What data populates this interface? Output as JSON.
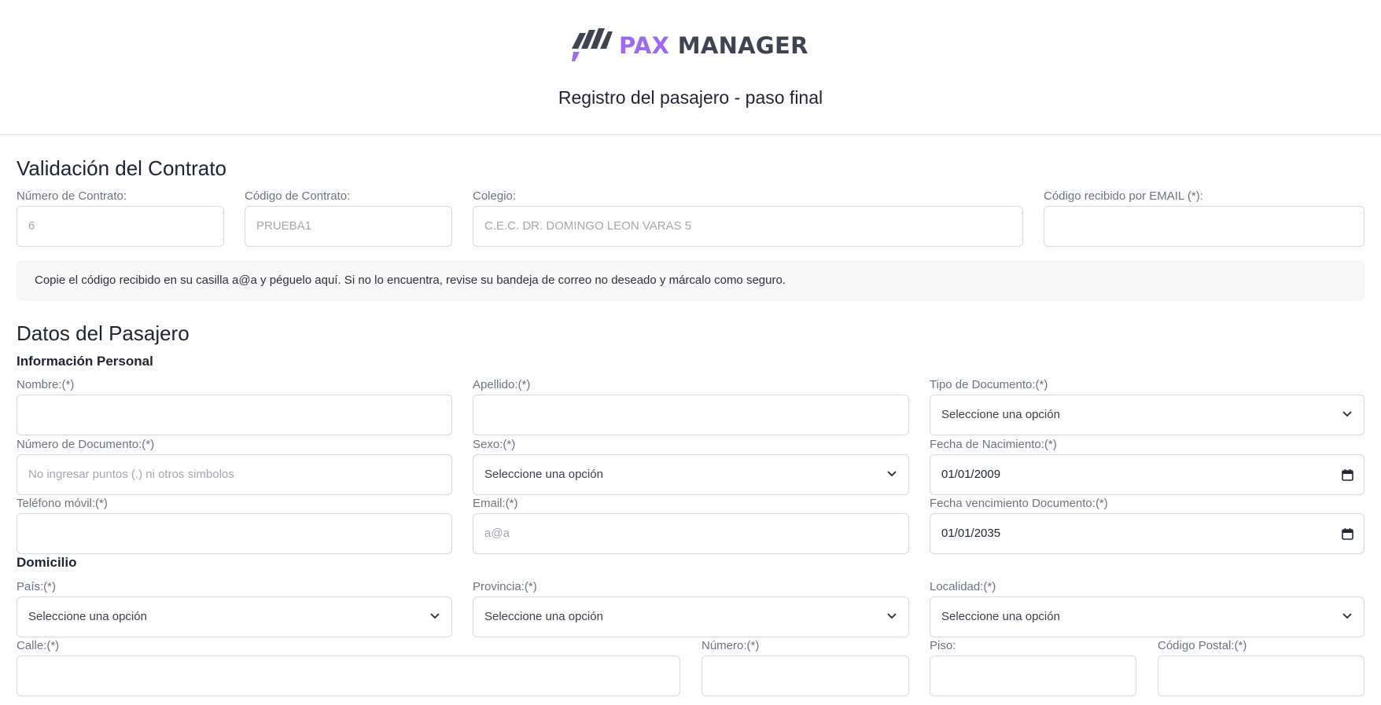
{
  "brand": {
    "pax": "PAX",
    "manager": "MANAGER",
    "accent": "#9d6af2",
    "dark": "#3f4453"
  },
  "page_title": "Registro del pasajero - paso final",
  "contract": {
    "title": "Validación del Contrato",
    "numero_label": "Número de Contrato:",
    "numero_value": "6",
    "codigo_label": "Código de Contrato:",
    "codigo_value": "PRUEBA1",
    "colegio_label": "Colegio:",
    "colegio_value": "C.E.C. DR. DOMINGO LEON VARAS 5",
    "email_code_label": "Código recibido por EMAIL (*):",
    "email_code_value": "",
    "notice": "Copie el código recibido en su casilla a@a y péguelo aquí. Si no lo encuentra, revise su bandeja de correo no deseado y márcalo como seguro."
  },
  "passenger": {
    "title": "Datos del Pasajero",
    "personal_title": "Información Personal",
    "nombre_label": "Nombre:(*)",
    "nombre_value": "",
    "apellido_label": "Apellido:(*)",
    "apellido_value": "",
    "tipo_doc_label": "Tipo de Documento:(*)",
    "tipo_doc_value": "Seleccione una opción",
    "num_doc_label": "Número de Documento:(*)",
    "num_doc_placeholder": "No ingresar puntos (.) ni otros simbolos",
    "sexo_label": "Sexo:(*)",
    "sexo_value": "Seleccione una opción",
    "nacimiento_label": "Fecha de Nacimiento:(*)",
    "nacimiento_value": "01/01/2009",
    "telefono_label": "Teléfono móvil:(*)",
    "telefono_value": "",
    "email_label": "Email:(*)",
    "email_value": "a@a",
    "venc_doc_label": "Fecha vencimiento Documento:(*)",
    "venc_doc_value": "01/01/2035"
  },
  "address": {
    "title": "Domicilio",
    "pais_label": "País:(*)",
    "pais_value": "Seleccione una opción",
    "provincia_label": "Provincia:(*)",
    "provincia_value": "Seleccione una opción",
    "localidad_label": "Localidad:(*)",
    "localidad_value": "Seleccione una opción",
    "calle_label": "Calle:(*)",
    "numero_label": "Número:(*)",
    "piso_label": "Piso:",
    "cp_label": "Código Postal:(*)"
  }
}
